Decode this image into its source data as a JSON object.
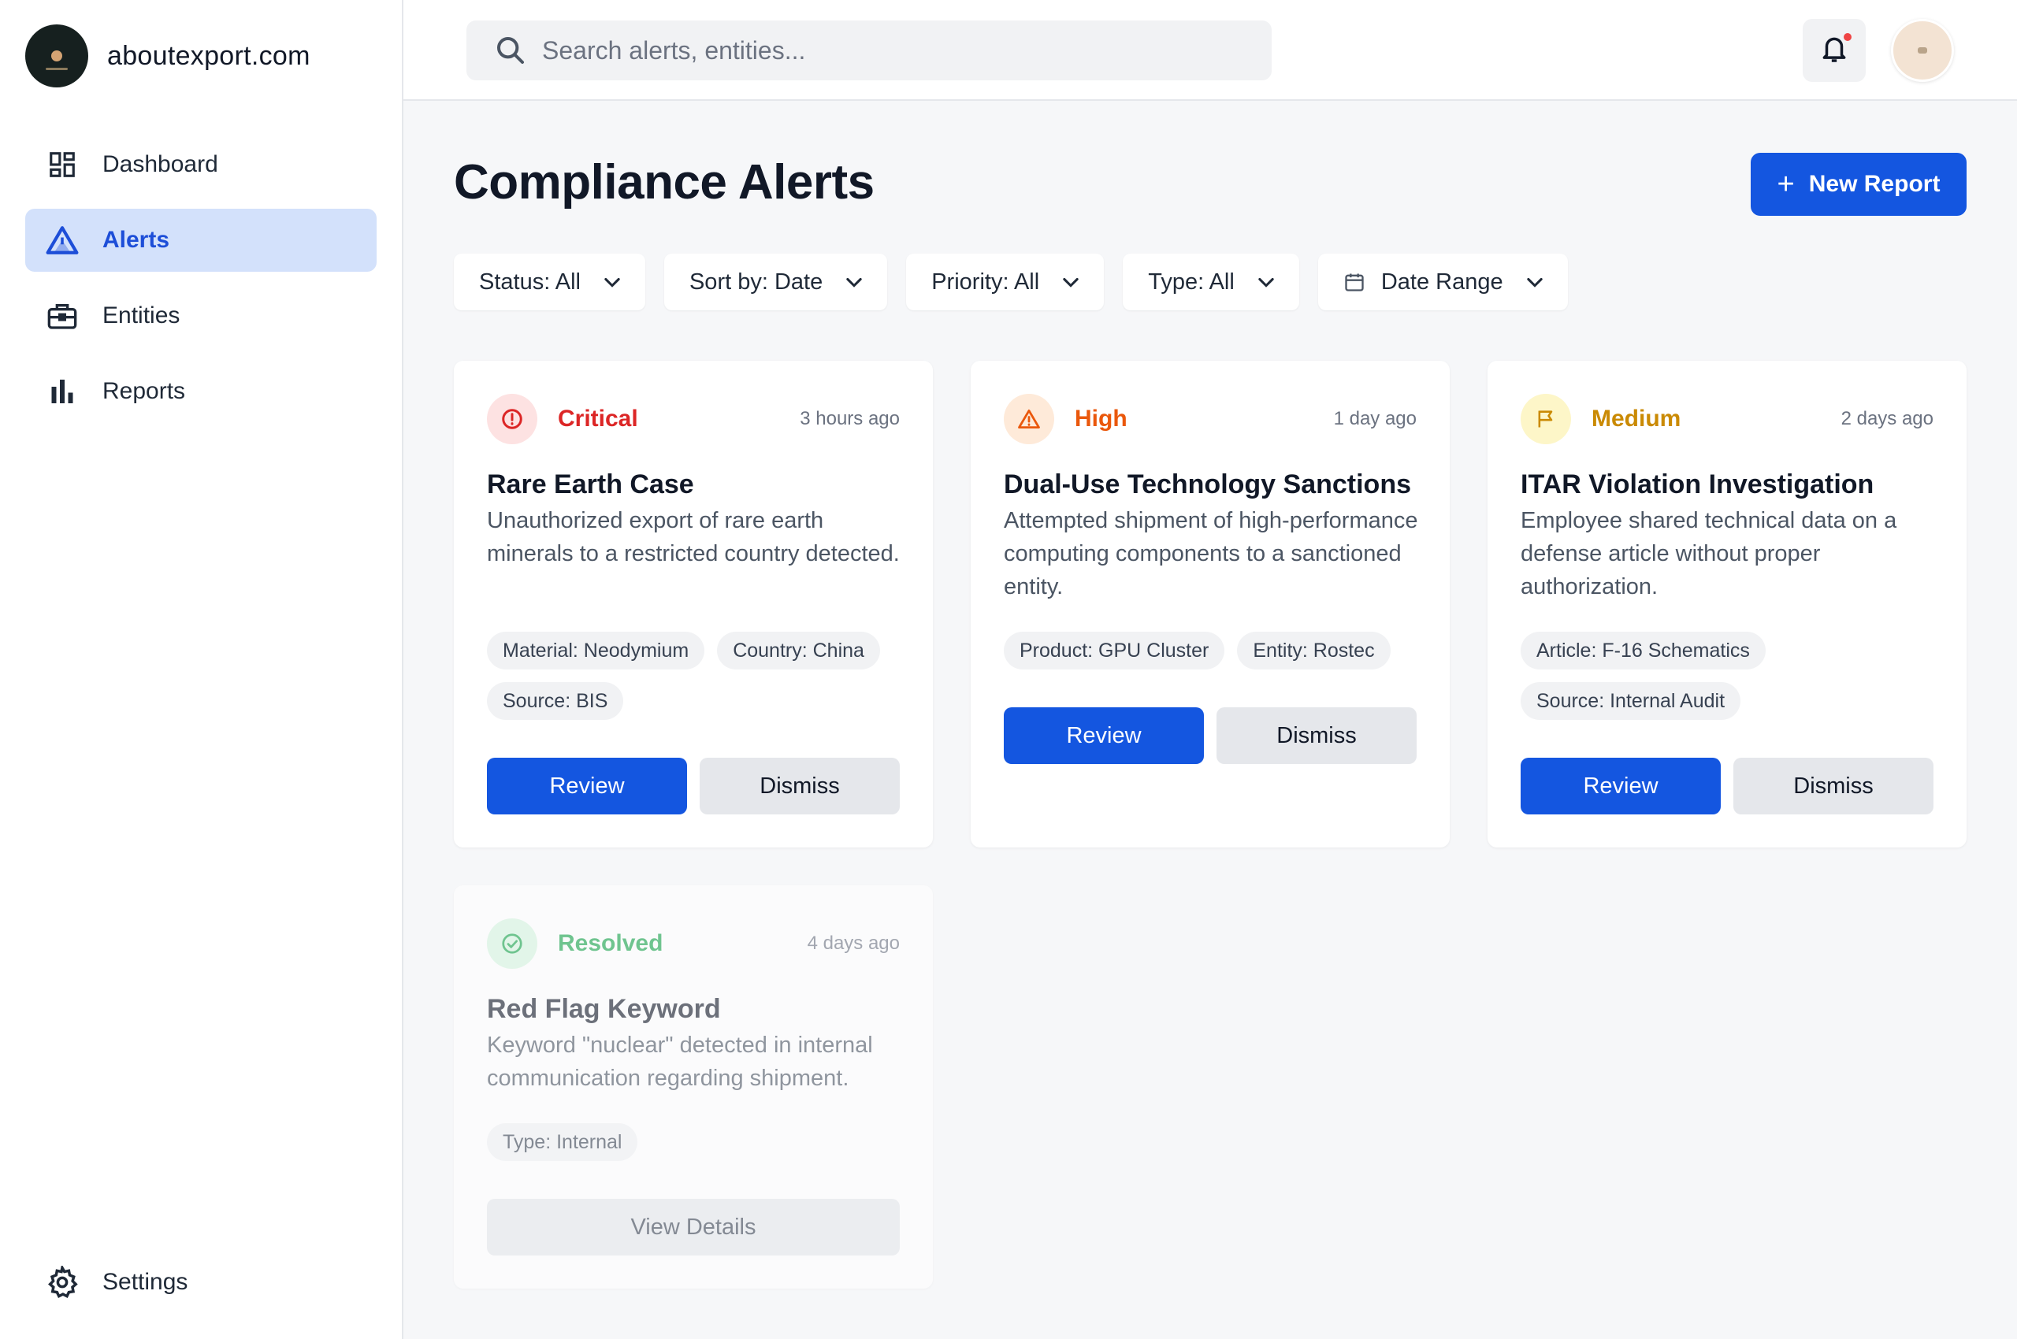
{
  "brand": {
    "name": "aboutexport.com"
  },
  "nav": {
    "items": [
      {
        "label": "Dashboard",
        "icon": "dashboard-icon"
      },
      {
        "label": "Alerts",
        "icon": "alert-triangle-icon",
        "active": true
      },
      {
        "label": "Entities",
        "icon": "briefcase-icon"
      },
      {
        "label": "Reports",
        "icon": "bar-chart-icon"
      }
    ],
    "settings": {
      "label": "Settings",
      "icon": "gear-icon"
    }
  },
  "search": {
    "placeholder": "Search alerts, entities..."
  },
  "page": {
    "title": "Compliance Alerts",
    "new_report_label": "New Report"
  },
  "filters": [
    {
      "label": "Status: All"
    },
    {
      "label": "Sort by: Date"
    },
    {
      "label": "Priority: All"
    },
    {
      "label": "Type: All"
    },
    {
      "label": "Date Range",
      "icon": "calendar-icon"
    }
  ],
  "colors": {
    "accent": "#1456e0",
    "critical": "#dc2626",
    "high": "#ea580c",
    "medium": "#ca8a04",
    "resolved": "#16a34a"
  },
  "alerts": [
    {
      "severity": "Critical",
      "time": "3 hours ago",
      "title": "Rare Earth Case",
      "description": "Unauthorized export of rare earth minerals to a restricted country detected.",
      "tags": [
        "Material: Neodymium",
        "Country: China",
        "Source: BIS"
      ],
      "review_label": "Review",
      "dismiss_label": "Dismiss"
    },
    {
      "severity": "High",
      "time": "1 day ago",
      "title": "Dual-Use Technology Sanctions",
      "description": "Attempted shipment of high-performance computing components to a sanctioned entity.",
      "tags": [
        "Product: GPU Cluster",
        "Entity: Rostec"
      ],
      "review_label": "Review",
      "dismiss_label": "Dismiss"
    },
    {
      "severity": "Medium",
      "time": "2 days ago",
      "title": "ITAR Violation Investigation",
      "description": "Employee shared technical data on a defense article without proper authorization.",
      "tags": [
        "Article: F-16 Schematics",
        "Source: Internal Audit"
      ],
      "review_label": "Review",
      "dismiss_label": "Dismiss"
    },
    {
      "severity": "Resolved",
      "time": "4 days ago",
      "title": "Red Flag Keyword",
      "description": "Keyword \"nuclear\" detected in internal communication regarding shipment.",
      "tags": [
        "Type: Internal"
      ],
      "details_label": "View Details"
    }
  ]
}
